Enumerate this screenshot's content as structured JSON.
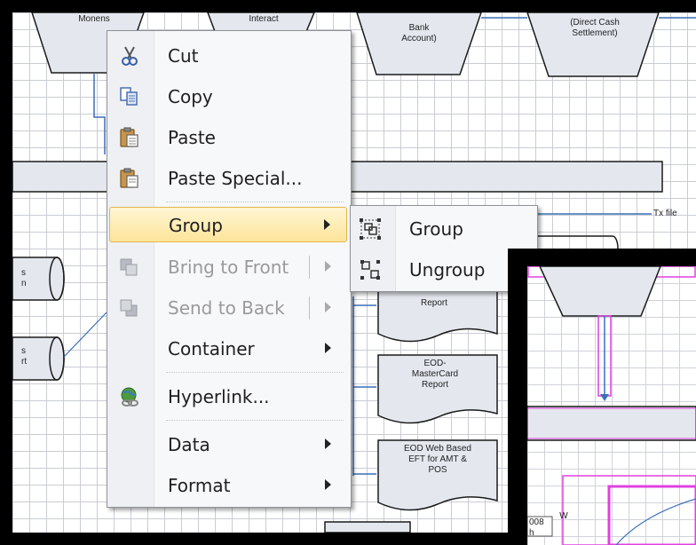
{
  "diagram": {
    "shape_labels": {
      "top_left": "Monens",
      "top_mid": "Interact",
      "bank": "Bank\nAccount)",
      "direct": "(Direct Cash\nSettlement)",
      "tx_file": "Tx file",
      "left_1": "s\nn",
      "left_2": "s\nrt",
      "report_1": "Report",
      "report_2": "EOD-\nMasterCard\nReport",
      "report_3": "EOD Web Based\nEFT for AMT &\nPOS",
      "inset_code": "008\nh",
      "inset_mark": "W"
    }
  },
  "context_menu": {
    "items": [
      {
        "label": "Cut",
        "icon": "scissors-icon"
      },
      {
        "label": "Copy",
        "icon": "copy-icon"
      },
      {
        "label": "Paste",
        "icon": "paste-icon"
      },
      {
        "label": "Paste Special...",
        "icon": "paste-special-icon"
      },
      {
        "label": "Group",
        "icon": "",
        "highlighted": true
      },
      {
        "label": "Bring to Front",
        "icon": "bring-to-front-icon",
        "disabled": true
      },
      {
        "label": "Send to Back",
        "icon": "send-to-back-icon",
        "disabled": true
      },
      {
        "label": "Container",
        "icon": ""
      },
      {
        "label": "Hyperlink...",
        "icon": "hyperlink-icon"
      },
      {
        "label": "Data",
        "icon": ""
      },
      {
        "label": "Format",
        "icon": ""
      }
    ]
  },
  "group_submenu": {
    "items": [
      {
        "label": "Group",
        "icon": "group-icon"
      },
      {
        "label": "Ungroup",
        "icon": "ungroup-icon"
      }
    ]
  },
  "colors": {
    "menu_bg": "#f7f8fa",
    "highlight_top": "#fff6d4",
    "highlight_bottom": "#fde49a",
    "highlight_border": "#e3b54e",
    "connector_blue": "#3a6fb7",
    "selection_magenta": "#e040e0"
  }
}
